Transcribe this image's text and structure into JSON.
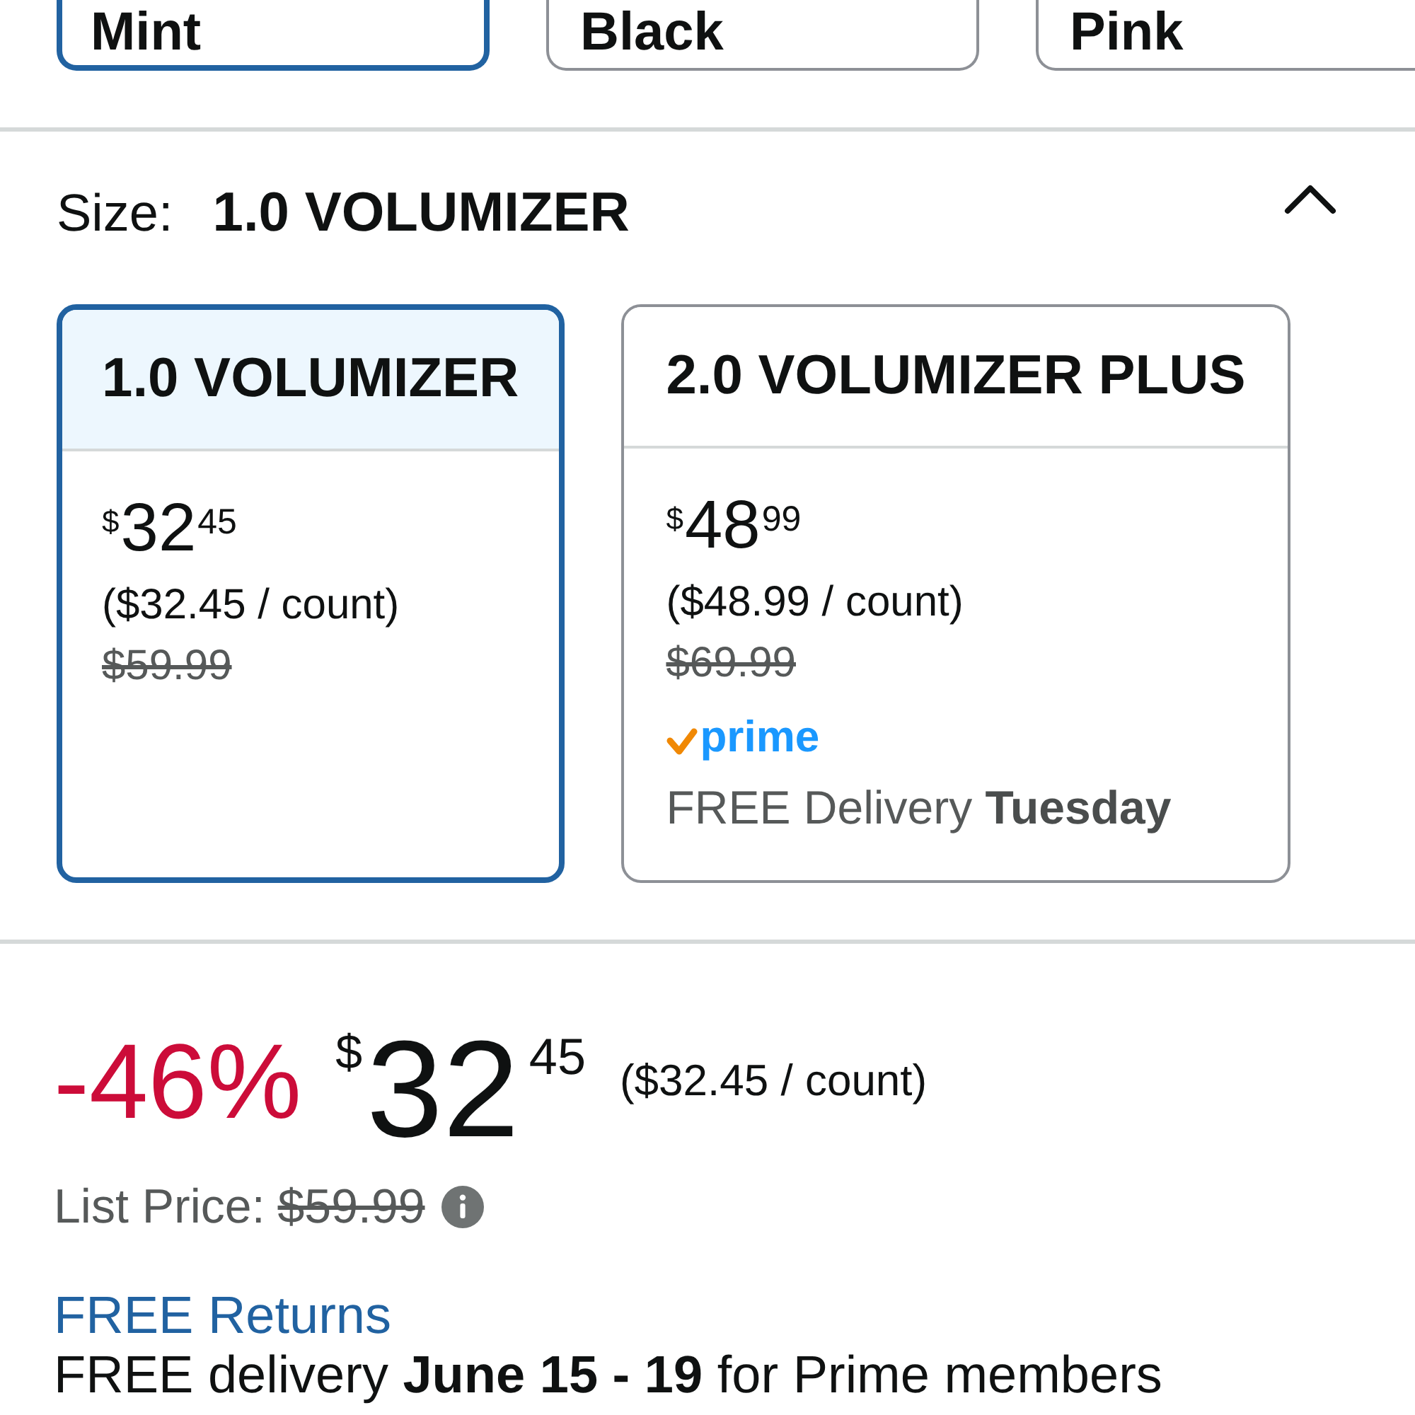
{
  "color_options": [
    {
      "label": "Mint",
      "selected": true
    },
    {
      "label": "Black",
      "selected": false
    },
    {
      "label": "Pink",
      "selected": false
    }
  ],
  "size": {
    "label": "Size:",
    "value": "1.0 VOLUMIZER",
    "expanded": true
  },
  "size_options": [
    {
      "name": "1.0 VOLUMIZER",
      "selected": true,
      "currency": "$",
      "whole": "32",
      "fraction": "45",
      "unit_price": "($32.45 / count)",
      "list_price": "$59.99"
    },
    {
      "name": "2.0 VOLUMIZER PLUS",
      "selected": false,
      "currency": "$",
      "whole": "48",
      "fraction": "99",
      "unit_price": "($48.99 / count)",
      "list_price": "$69.99",
      "prime_label": "prime",
      "delivery": "FREE Delivery **Tuesday**"
    }
  ],
  "price": {
    "discount": "-46%",
    "currency": "$",
    "whole": "32",
    "fraction": "45",
    "unit_price": "($32.45 / count)"
  },
  "list_price": {
    "label": "List Price:",
    "value": "$59.99"
  },
  "returns_link": "FREE Returns",
  "delivery": "FREE delivery **June 15 - 19** for Prime members"
}
